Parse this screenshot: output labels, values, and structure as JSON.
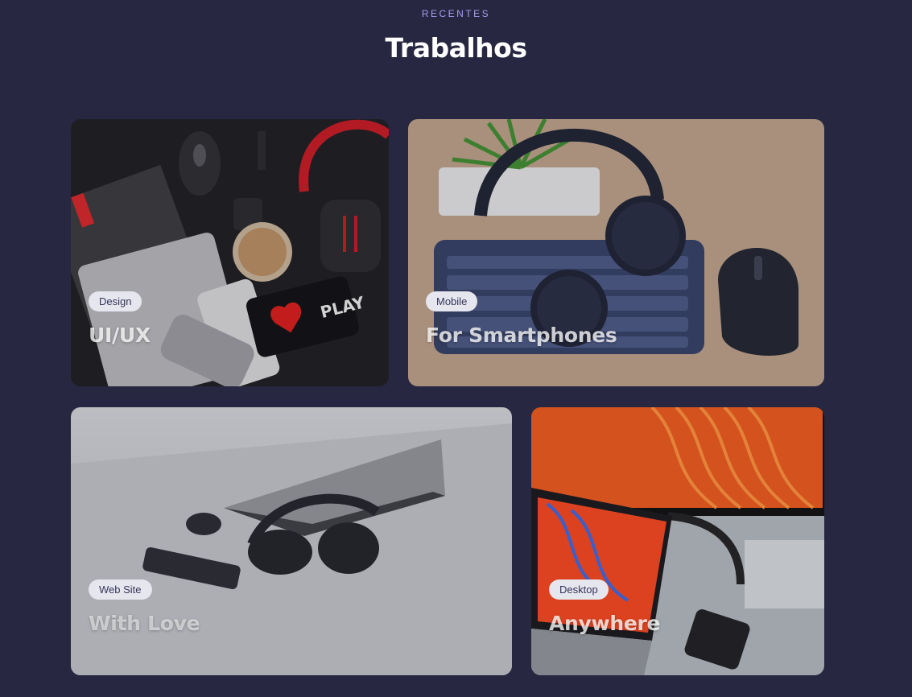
{
  "section": {
    "eyebrow": "RECENTES",
    "title": "Trabalhos"
  },
  "works": [
    {
      "tag": "Design",
      "title": "UI/UX",
      "image": "desk-gadgets-photo"
    },
    {
      "tag": "Mobile",
      "title": "For Smartphones",
      "image": "headphones-keyboard-photo"
    },
    {
      "tag": "Web Site",
      "title": "With Love",
      "image": "laptop-headphones-photo"
    },
    {
      "tag": "Desktop",
      "title": "Anywhere",
      "image": "monitor-laptop-photo"
    }
  ],
  "colors": {
    "background": "#272741",
    "eyebrow": "#a69cf0",
    "title": "#ffffff",
    "tag_bg": "#e6e6ee",
    "tag_text": "#35355a"
  }
}
